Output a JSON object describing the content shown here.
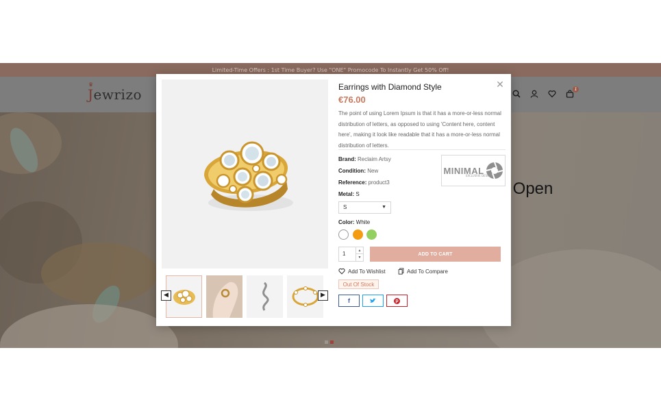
{
  "site": {
    "promo_text": "Limited-Time Offers : 1st Time Buyer? Use \"ONE\" Promocode To Instantly Get 50% Off!",
    "logo_text_j": "J",
    "logo_text_rest": "ewrizo",
    "cart_count": "1",
    "hero_title": "y Open",
    "colors": {
      "promo_bg": "#8a6a5e",
      "accent": "#c9785d",
      "dot_active": "#a0423a"
    }
  },
  "modal": {
    "title": "Earrings with Diamond Style",
    "price": "€76.00",
    "description": "The point of using Lorem Ipsum is that it has a more-or-less normal distribution of letters, as opposed to using 'Content here, content here', making it look like readable that it has a more-or-less normal distribution of letters.",
    "brand_label": "Brand:",
    "brand_value": "Reclaim Artsy",
    "condition_label": "Condition:",
    "condition_value": "New",
    "reference_label": "Reference:",
    "reference_value": "product3",
    "brand_logo_text": "MINIMAL",
    "brand_logo_sub": "EXCLUSIVE DESIGN",
    "metal_label": "Metal:",
    "metal_value": "S",
    "metal_select_value": "S",
    "color_label": "Color:",
    "color_value": "White",
    "swatches": [
      {
        "name": "White",
        "color": "#ffffff"
      },
      {
        "name": "Orange",
        "color": "#f39c12"
      },
      {
        "name": "Green",
        "color": "#94d060"
      }
    ],
    "quantity": "1",
    "add_to_cart": "ADD TO CART",
    "wishlist": "Add To Wishlist",
    "compare": "Add To Compare",
    "stock_status": "Out Of Stock",
    "share_icons": [
      "facebook-icon",
      "twitter-icon",
      "pinterest-icon"
    ],
    "thumbnails": [
      "ring",
      "hand-ring",
      "silver-earring",
      "bracelet"
    ]
  }
}
